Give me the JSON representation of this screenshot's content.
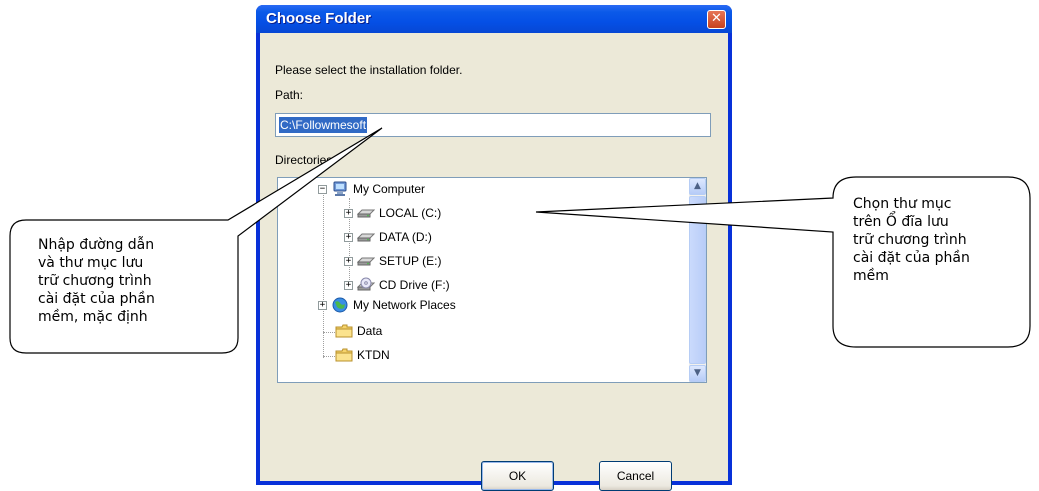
{
  "dialog": {
    "title": "Choose Folder",
    "prompt": "Please select the installation folder.",
    "path_label": "Path:",
    "path_value": "C:\\Followmesoft",
    "directories_label": "Directories:",
    "ok_label": "OK",
    "cancel_label": "Cancel"
  },
  "tree": {
    "root": {
      "label": "My Computer",
      "icon": "my-computer-icon"
    },
    "drives": [
      {
        "label": "LOCAL (C:)",
        "icon": "hard-drive-icon"
      },
      {
        "label": "DATA (D:)",
        "icon": "hard-drive-icon"
      },
      {
        "label": "SETUP (E:)",
        "icon": "hard-drive-icon"
      },
      {
        "label": "CD Drive (F:)",
        "icon": "cd-drive-icon"
      }
    ],
    "network": {
      "label": "My Network Places",
      "icon": "network-places-icon"
    },
    "folders": [
      {
        "label": "Data",
        "icon": "folder-icon"
      },
      {
        "label": "KTDN",
        "icon": "folder-icon"
      }
    ]
  },
  "callouts": {
    "left": [
      "Nhập đường dẫn",
      "và thư mục lưu",
      "trữ chương trình",
      "cài đặt của phần",
      "mềm, mặc định"
    ],
    "right": [
      "Chọn thư mục",
      "trên Ổ đĩa lưu",
      "trữ chương trình",
      "cài đặt của phần",
      "mềm"
    ]
  },
  "colors": {
    "title_bar": "#0a5ae6",
    "dialog_face": "#ece9d8",
    "selection": "#316ac5"
  }
}
